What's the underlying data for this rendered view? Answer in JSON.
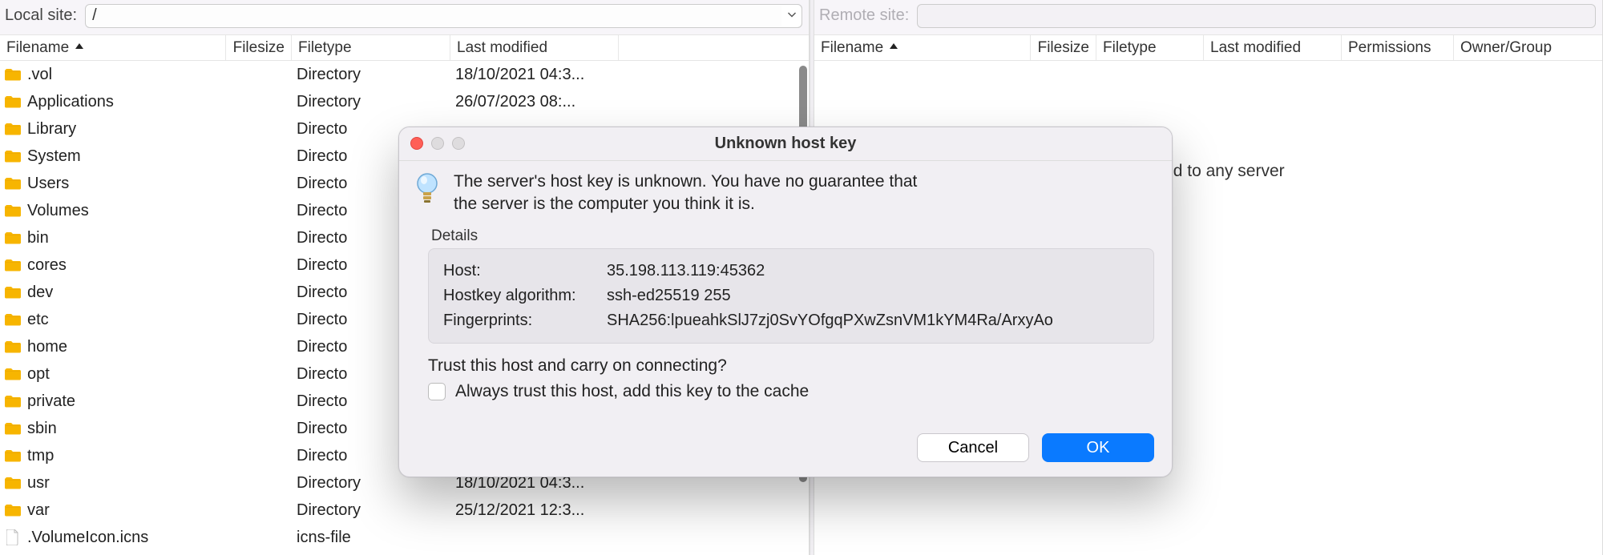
{
  "local": {
    "label": "Local site:",
    "path": "/",
    "columns": {
      "filename": "Filename",
      "filesize": "Filesize",
      "filetype": "Filetype",
      "lastmod": "Last modified"
    },
    "rows": [
      {
        "name": ".vol",
        "type": "Directory",
        "mod": "18/10/2021 04:3...",
        "icon": "folder"
      },
      {
        "name": "Applications",
        "type": "Directory",
        "mod": "26/07/2023 08:...",
        "icon": "folder"
      },
      {
        "name": "Library",
        "type": "Directo",
        "mod": "",
        "icon": "folder"
      },
      {
        "name": "System",
        "type": "Directo",
        "mod": "",
        "icon": "folder"
      },
      {
        "name": "Users",
        "type": "Directo",
        "mod": "",
        "icon": "folder"
      },
      {
        "name": "Volumes",
        "type": "Directo",
        "mod": "",
        "icon": "folder"
      },
      {
        "name": "bin",
        "type": "Directo",
        "mod": "",
        "icon": "folder"
      },
      {
        "name": "cores",
        "type": "Directo",
        "mod": "",
        "icon": "folder"
      },
      {
        "name": "dev",
        "type": "Directo",
        "mod": "",
        "icon": "folder"
      },
      {
        "name": "etc",
        "type": "Directo",
        "mod": "",
        "icon": "folder"
      },
      {
        "name": "home",
        "type": "Directo",
        "mod": "",
        "icon": "folder"
      },
      {
        "name": "opt",
        "type": "Directo",
        "mod": "",
        "icon": "folder"
      },
      {
        "name": "private",
        "type": "Directo",
        "mod": "",
        "icon": "folder"
      },
      {
        "name": "sbin",
        "type": "Directo",
        "mod": "",
        "icon": "folder"
      },
      {
        "name": "tmp",
        "type": "Directo",
        "mod": "",
        "icon": "folder"
      },
      {
        "name": "usr",
        "type": "Directory",
        "mod": "18/10/2021 04:3...",
        "icon": "folder"
      },
      {
        "name": "var",
        "type": "Directory",
        "mod": "25/12/2021 12:3...",
        "icon": "folder"
      },
      {
        "name": ".VolumeIcon.icns",
        "type": "icns-file",
        "mod": "",
        "icon": "file"
      }
    ],
    "col_widths": {
      "name": 336,
      "size": 82,
      "type": 198,
      "mod": 210
    }
  },
  "remote": {
    "label": "Remote site:",
    "path": "",
    "columns": {
      "filename": "Filename",
      "filesize": "Filesize",
      "filetype": "Filetype",
      "lastmod": "Last modified",
      "permissions": "Permissions",
      "owner": "Owner/Group"
    },
    "empty_msg_suffix": "nected to any server",
    "col_widths": {
      "name": 270,
      "size": 82,
      "type": 134,
      "mod": 172,
      "perm": 140,
      "owner": 170
    }
  },
  "dialog": {
    "title": "Unknown host key",
    "message_l1": "The server's host key is unknown. You have no guarantee that",
    "message_l2": "the server is the computer you think it is.",
    "details_label": "Details",
    "host_label": "Host:",
    "host_value": "35.198.113.119:45362",
    "algo_label": "Hostkey algorithm:",
    "algo_value": "ssh-ed25519 255",
    "fp_label": "Fingerprints:",
    "fp_value": "SHA256:lpueahkSlJ7zj0SvYOfgqPXwZsnVM1kYM4Ra/ArxyAo",
    "trust_question": "Trust this host and carry on connecting?",
    "checkbox_label": "Always trust this host, add this key to the cache",
    "cancel": "Cancel",
    "ok": "OK"
  }
}
